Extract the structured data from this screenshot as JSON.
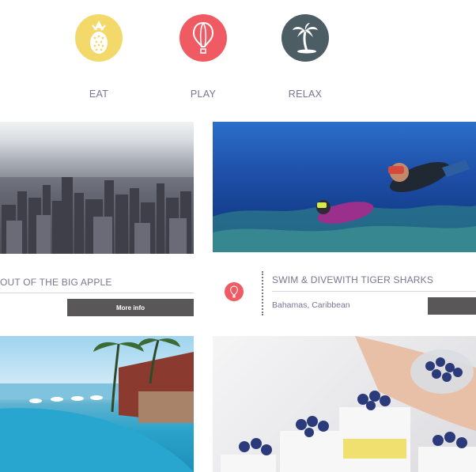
{
  "categories": [
    {
      "label": "EAT",
      "icon": "pineapple-icon",
      "color": "#f3d96a"
    },
    {
      "label": "PLAY",
      "icon": "hot-air-balloon-icon",
      "color": "#ef5a63"
    },
    {
      "label": "RELAX",
      "icon": "palm-tree-icon",
      "color": "#4d5d64"
    }
  ],
  "cards": {
    "apple": {
      "title": "OUT OF THE BIG APPLE",
      "button": "More info"
    },
    "shark": {
      "title": "SWIM & DIVEWITH TIGER SHARKS",
      "location": "Bahamas, Caribbean",
      "badge_icon": "hot-air-balloon-icon"
    }
  },
  "colors": {
    "accent_red": "#ef5a63",
    "button_gray": "#5a5758",
    "text_muted": "#7a7592"
  }
}
